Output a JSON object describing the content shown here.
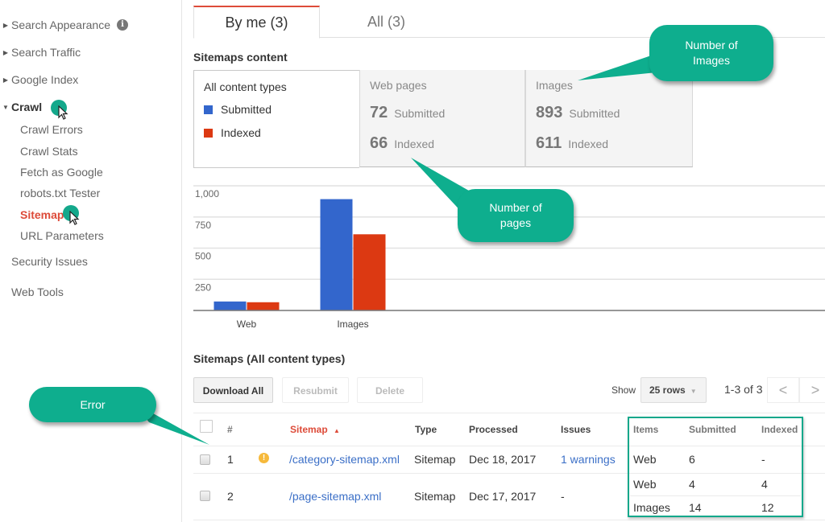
{
  "sidebar": {
    "items": [
      {
        "label": "Search Appearance",
        "expanded": false,
        "has_info": true
      },
      {
        "label": "Search Traffic",
        "expanded": false
      },
      {
        "label": "Google Index",
        "expanded": false
      },
      {
        "label": "Crawl",
        "expanded": true
      }
    ],
    "crawl_children": [
      {
        "label": "Crawl Errors"
      },
      {
        "label": "Crawl Stats"
      },
      {
        "label": "Fetch as Google"
      },
      {
        "label": "robots.txt Tester"
      },
      {
        "label": "Sitemaps",
        "active": true
      },
      {
        "label": "URL Parameters"
      }
    ],
    "bottom_items": [
      {
        "label": "Security Issues"
      },
      {
        "label": "Web Tools"
      }
    ],
    "info_glyph": "i"
  },
  "tabs": [
    {
      "label": "By me (3)",
      "active": true
    },
    {
      "label": "All (3)",
      "active": false
    }
  ],
  "content": {
    "title": "Sitemaps content",
    "legend": {
      "label": "All content types",
      "submitted": "Submitted",
      "indexed": "Indexed"
    },
    "web_pages": {
      "title": "Web pages",
      "submitted": "72",
      "submitted_label": "Submitted",
      "indexed": "66",
      "indexed_label": "Indexed"
    },
    "images": {
      "title": "Images",
      "submitted": "893",
      "submitted_label": "Submitted",
      "indexed": "611",
      "indexed_label": "Indexed"
    }
  },
  "colors": {
    "submitted": "#3366cc",
    "indexed": "#dc3912",
    "accent": "#dd4b39",
    "callout": "#0eae8e",
    "link": "#3b6fc7"
  },
  "chart_data": {
    "type": "bar",
    "categories": [
      "Web",
      "Images"
    ],
    "series": [
      {
        "name": "Submitted",
        "values": [
          72,
          893
        ]
      },
      {
        "name": "Indexed",
        "values": [
          66,
          611
        ]
      }
    ],
    "yticks": [
      "250",
      "500",
      "750",
      "1,000"
    ],
    "ytick_values": [
      250,
      500,
      750,
      1000
    ],
    "ylim": [
      0,
      1000
    ],
    "grid": true,
    "title": "",
    "xlabel": "",
    "ylabel": ""
  },
  "table": {
    "title": "Sitemaps (All content types)",
    "buttons": {
      "download_all": "Download All",
      "resubmit": "Resubmit",
      "delete": "Delete"
    },
    "show_label": "Show",
    "rows_select": "25 rows",
    "range": "1-3 of 3",
    "prev_glyph": "<",
    "next_glyph": ">",
    "columns": [
      "#",
      "Sitemap",
      "Type",
      "Processed",
      "Issues",
      "Items",
      "Submitted",
      "Indexed"
    ],
    "sort_glyph": "▲",
    "rows": [
      {
        "num": "1",
        "warning": true,
        "sitemap": "/category-sitemap.xml",
        "type": "Sitemap",
        "processed": "Dec 18, 2017",
        "issues": "1 warnings",
        "items": [
          {
            "item": "Web",
            "submitted": "6",
            "indexed": "-"
          }
        ]
      },
      {
        "num": "2",
        "warning": false,
        "sitemap": "/page-sitemap.xml",
        "type": "Sitemap",
        "processed": "Dec 17, 2017",
        "issues": "-",
        "items": [
          {
            "item": "Web",
            "submitted": "4",
            "indexed": "4"
          },
          {
            "item": "Images",
            "submitted": "14",
            "indexed": "12"
          }
        ]
      }
    ],
    "warning_glyph": "!"
  },
  "callouts": {
    "images": "Number of Images",
    "pages": "Number of pages",
    "error": "Error"
  }
}
